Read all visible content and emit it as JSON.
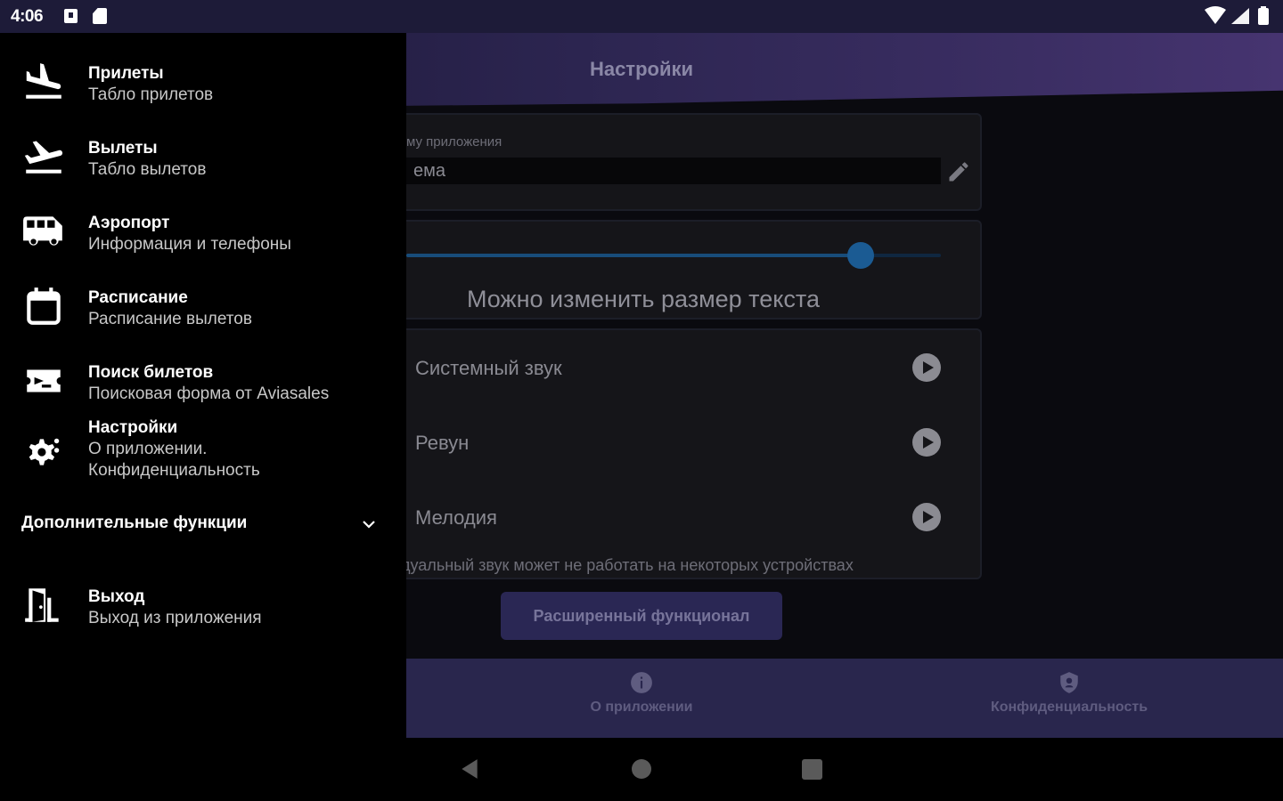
{
  "status_bar": {
    "time": "4:06"
  },
  "app": {
    "title": "Настройки",
    "theme_field": {
      "label": "му приложения",
      "value": "ема"
    },
    "text_size": {
      "hint": "Можно изменить размер текста",
      "level": 0.85
    },
    "sounds": [
      {
        "label": "Системный звук"
      },
      {
        "label": "Ревун"
      },
      {
        "label": "Мелодия"
      }
    ],
    "sound_note": "дуальный звук может не работать на некоторых устройствах",
    "extended_button": "Расширенный функционал",
    "bottom_nav": {
      "about": "О приложении",
      "privacy": "Конфиденциальность"
    }
  },
  "drawer": {
    "items": [
      {
        "icon": "plane-landing-icon",
        "title": "Прилеты",
        "subtitle": "Табло прилетов"
      },
      {
        "icon": "plane-takeoff-icon",
        "title": "Вылеты",
        "subtitle": "Табло вылетов"
      },
      {
        "icon": "bus-icon",
        "title": "Аэропорт",
        "subtitle": "Информация и телефоны"
      },
      {
        "icon": "calendar-icon",
        "title": "Расписание",
        "subtitle": "Расписание вылетов"
      },
      {
        "icon": "ticket-search-icon",
        "title": "Поиск билетов",
        "subtitle": "Поисковая форма от Aviasales"
      },
      {
        "icon": "settings-icon",
        "title": "Настройки",
        "subtitle": "О приложении.",
        "subtitle2": "Конфиденциальность"
      }
    ],
    "extra_section": "Дополнительные функции",
    "exit": {
      "icon": "exit-door-icon",
      "title": "Выход",
      "subtitle": "Выход из приложения"
    }
  },
  "colors": {
    "status_bar": "#1d1b38",
    "header_gradient_end": "#463470",
    "accent_slider": "#1b5b93",
    "bottom_nav": "#29264d",
    "extended_button": "#2a2754"
  }
}
